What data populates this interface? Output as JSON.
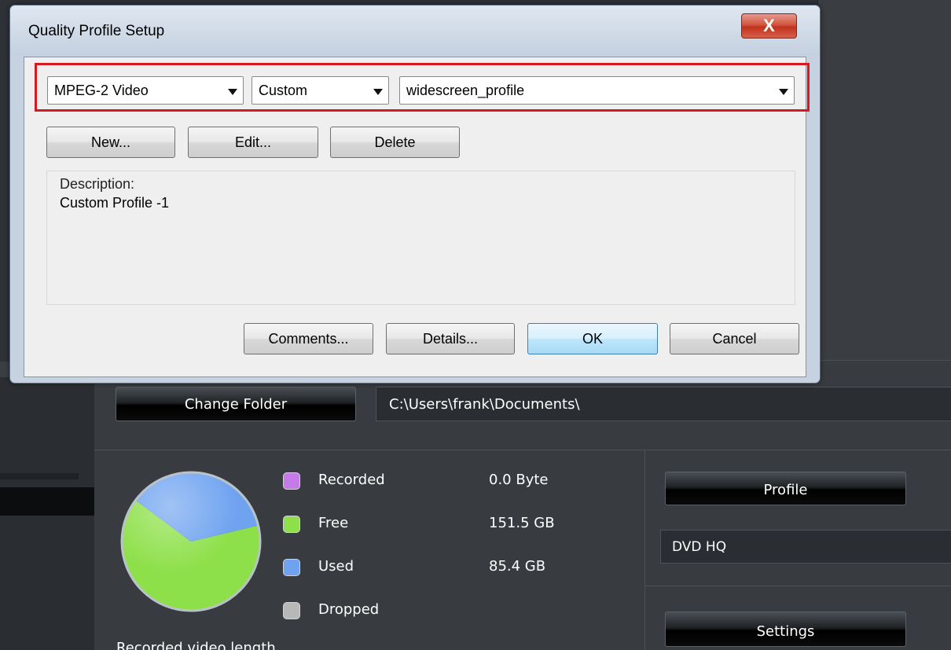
{
  "dialog": {
    "title": "Quality Profile Setup",
    "close_glyph": "X",
    "codec_value": "MPEG-2 Video",
    "quality_value": "Custom",
    "profile_value": "widescreen_profile",
    "buttons": {
      "new": "New...",
      "edit": "Edit...",
      "delete": "Delete",
      "comments": "Comments...",
      "details": "Details...",
      "ok": "OK",
      "cancel": "Cancel"
    },
    "description_label": "Description:",
    "description_text": "Custom Profile -1",
    "highlight_color": "#d51a23"
  },
  "background_app": {
    "change_folder_label": "Change Folder",
    "folder_path": "C:\\Users\\frank\\Documents\\",
    "profile_label": "Profile",
    "profile_value": "DVD HQ",
    "settings_label": "Settings",
    "cut_off_text": "Recorded video length",
    "storage_legend": [
      {
        "label": "Recorded",
        "value": "0.0  Byte",
        "color": "#c57ae8"
      },
      {
        "label": "Free",
        "value": "151.5  GB",
        "color": "#8ee04a"
      },
      {
        "label": "Used",
        "value": "85.4  GB",
        "color": "#6fa3f0"
      },
      {
        "label": "Dropped",
        "value": "",
        "color": "#b8b8b8"
      }
    ],
    "storage_pie": {
      "free_gb": 151.5,
      "used_gb": 85.4,
      "free_color": "#8ee04a",
      "used_color": "#6fa3f0"
    }
  }
}
